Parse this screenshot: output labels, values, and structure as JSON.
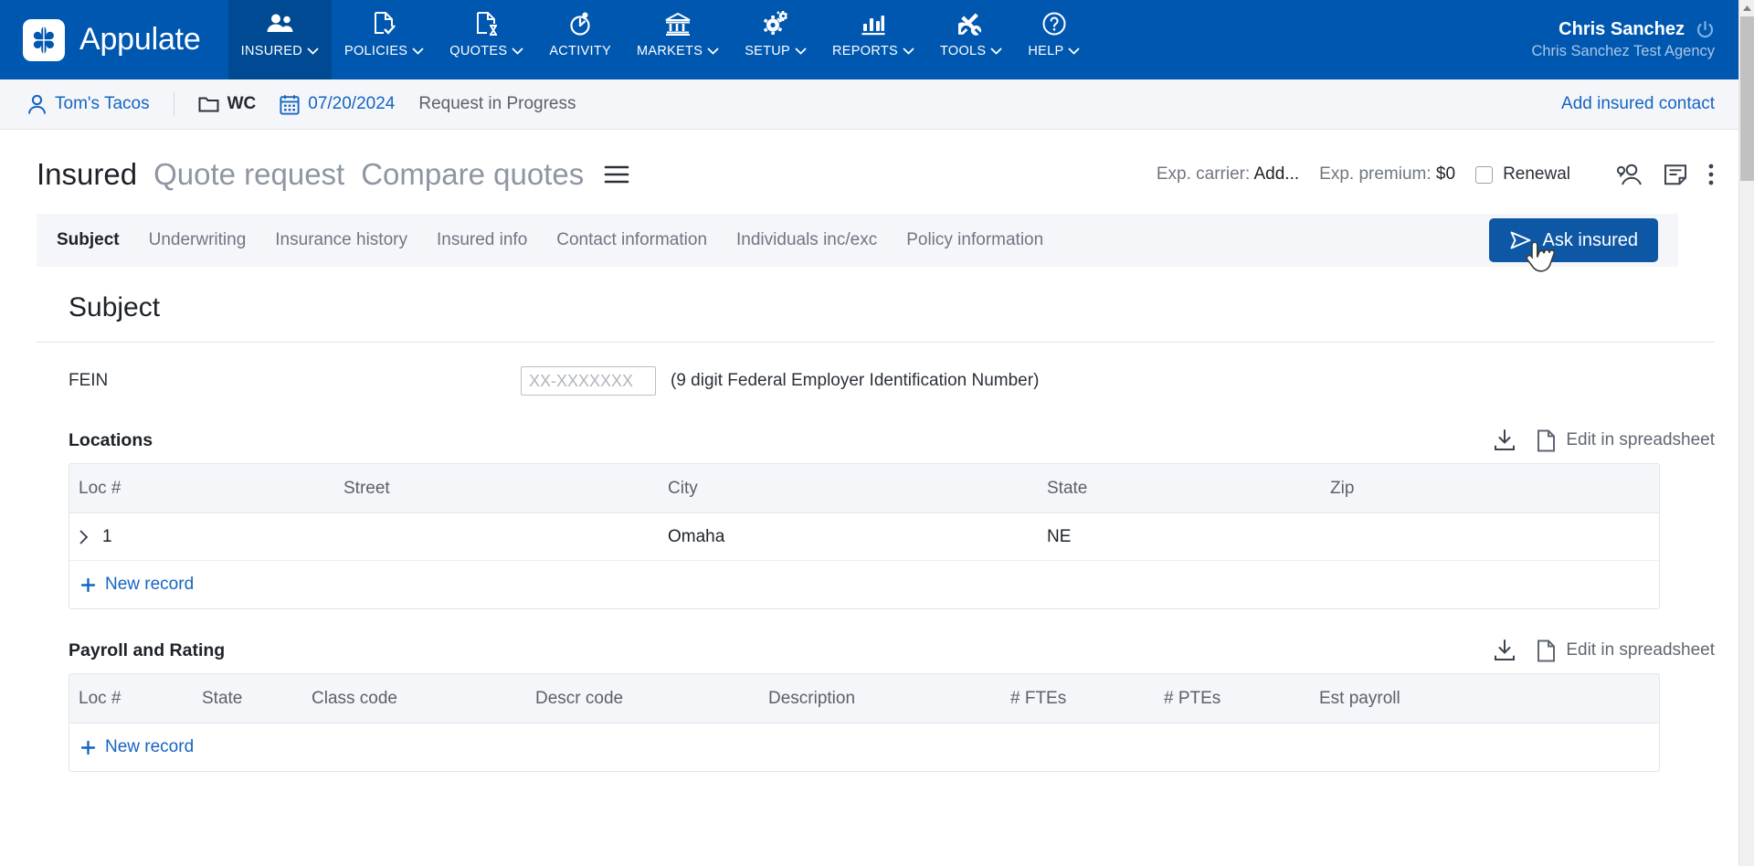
{
  "brand": {
    "name": "Appulate",
    "logo_icon": "clover-logo-icon"
  },
  "topnav": {
    "items": [
      {
        "label": "INSURED",
        "icon": "people-icon",
        "caret": "⌄",
        "active": true
      },
      {
        "label": "POLICIES",
        "icon": "document-check-icon",
        "caret": "⌄",
        "active": false
      },
      {
        "label": "QUOTES",
        "icon": "document-hourglass-icon",
        "caret": "⌄",
        "active": false
      },
      {
        "label": "ACTIVITY",
        "icon": "stopwatch-icon",
        "caret": "",
        "active": false
      },
      {
        "label": "MARKETS",
        "icon": "bank-icon",
        "caret": "⌄",
        "active": false
      },
      {
        "label": "SETUP",
        "icon": "gears-icon",
        "caret": "⌄",
        "active": false
      },
      {
        "label": "REPORTS",
        "icon": "bar-chart-icon",
        "caret": "⌄",
        "active": false
      },
      {
        "label": "TOOLS",
        "icon": "wrench-screwdriver-icon",
        "caret": "⌄",
        "active": false
      },
      {
        "label": "HELP",
        "icon": "question-circle-icon",
        "caret": "⌄",
        "active": false
      }
    ],
    "user_name": "Chris Sanchez",
    "user_agency": "Chris Sanchez Test Agency",
    "power_icon": "power-icon"
  },
  "breadcrumb": {
    "insured_name": "Tom's Tacos",
    "insured_icon": "person-icon",
    "folder_label": "WC",
    "folder_icon": "folder-icon",
    "date": "07/20/2024",
    "date_icon": "calendar-icon",
    "status": "Request in Progress",
    "add_contact": "Add insured contact"
  },
  "page_header": {
    "title_active": "Insured",
    "title_links": [
      "Quote request",
      "Compare quotes"
    ],
    "menu_icon": "hamburger-menu-icon",
    "exp_carrier_label": "Exp. carrier:",
    "exp_carrier_value": "Add...",
    "exp_premium_label": "Exp. premium:",
    "exp_premium_value": "$0",
    "renewal_label": "Renewal",
    "renewal_checked": false,
    "icons": [
      "contacts-person-icon",
      "note-icon",
      "more-vertical-icon"
    ]
  },
  "tabs": {
    "items": [
      {
        "label": "Subject",
        "active": true
      },
      {
        "label": "Underwriting",
        "active": false
      },
      {
        "label": "Insurance history",
        "active": false
      },
      {
        "label": "Insured info",
        "active": false
      },
      {
        "label": "Contact information",
        "active": false
      },
      {
        "label": "Individuals inc/exc",
        "active": false
      },
      {
        "label": "Policy information",
        "active": false
      }
    ],
    "ask_insured_label": "Ask insured",
    "ask_insured_icon": "send-plane-icon"
  },
  "subject": {
    "heading": "Subject",
    "fein_label": "FEIN",
    "fein_value": "",
    "fein_placeholder": "XX-XXXXXXX",
    "fein_hint": "(9 digit Federal Employer Identification Number)"
  },
  "locations": {
    "title": "Locations",
    "download_icon": "download-icon",
    "spreadsheet_icon": "file-icon",
    "spreadsheet_label": "Edit in spreadsheet",
    "columns": [
      "Loc #",
      "Street",
      "City",
      "State",
      "Zip"
    ],
    "rows": [
      {
        "expander": "›",
        "loc": "1",
        "street": "",
        "city": "Omaha",
        "state": "NE",
        "zip": ""
      }
    ],
    "new_record_label": "New record",
    "new_record_icon": "plus-icon"
  },
  "payroll": {
    "title": "Payroll and Rating",
    "download_icon": "download-icon",
    "spreadsheet_icon": "file-icon",
    "spreadsheet_label": "Edit in spreadsheet",
    "columns": [
      "Loc #",
      "State",
      "Class code",
      "Descr code",
      "Description",
      "# FTEs",
      "# PTEs",
      "Est payroll"
    ],
    "rows": [],
    "new_record_label": "New record",
    "new_record_icon": "plus-icon"
  },
  "colors": {
    "brand_blue": "#0057b0",
    "nav_active": "#004a94",
    "link_blue": "#1565c0",
    "button_blue": "#0d57a5",
    "panel_bg": "#f5f6fa",
    "border": "#e3e5ec"
  }
}
